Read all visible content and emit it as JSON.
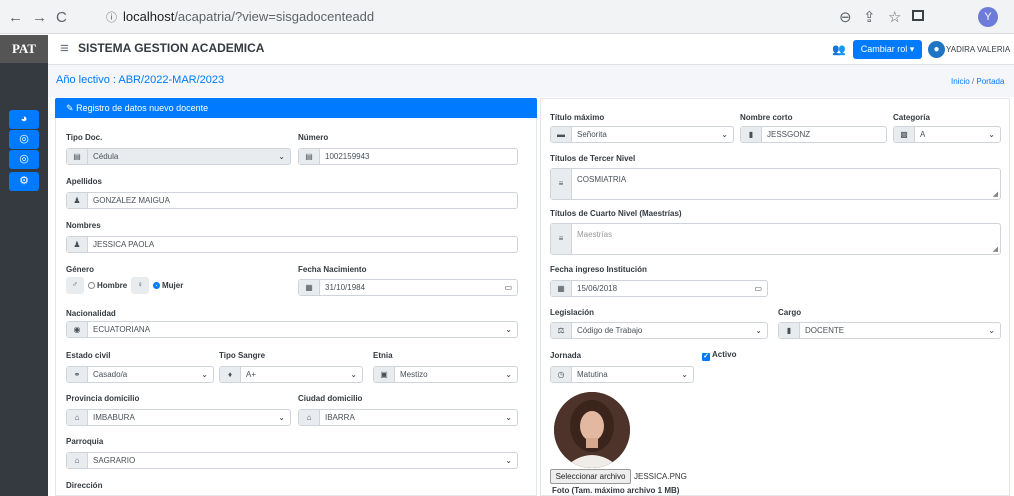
{
  "browser": {
    "url_host": "localhost",
    "url_path": "/acapatria/?view=sisgadocenteadd",
    "profile_initial": "Y"
  },
  "app": {
    "logo": "PAT",
    "title": "SISTEMA GESTION ACADEMICA",
    "role_button": "Cambiar rol",
    "user_name": "YADIRA VALERIA",
    "academic_year": "Año lectivo : ABR/2022-MAR/2023",
    "breadcrumb_home": "Inicio",
    "breadcrumb_sep": "/",
    "breadcrumb_current": "Portada",
    "sidebar_icons": [
      "dashboard-icon",
      "circle-icon",
      "circle-icon",
      "cogs-icon"
    ]
  },
  "form": {
    "header": "Registro de datos nuevo docente",
    "tipo_doc_label": "Tipo Doc.",
    "tipo_doc_value": "Cédula",
    "numero_label": "Número",
    "numero_value": "1002159943",
    "apellidos_label": "Apellidos",
    "apellidos_value": "GONZALEZ MAIGUA",
    "nombres_label": "Nombres",
    "nombres_value": "JESSICA PAOLA",
    "genero_label": "Género",
    "genero_hombre": "Hombre",
    "genero_mujer": "Mujer",
    "genero_selected": "Mujer",
    "fecha_nac_label": "Fecha Nacimiento",
    "fecha_nac_value": "31/10/1984",
    "nacionalidad_label": "Nacionalidad",
    "nacionalidad_value": "ECUATORIANA",
    "estado_civil_label": "Estado civil",
    "estado_civil_value": "Casado/a",
    "tipo_sangre_label": "Tipo Sangre",
    "tipo_sangre_value": "A+",
    "etnia_label": "Etnia",
    "etnia_value": "Mestizo",
    "provincia_label": "Provincia domicilio",
    "provincia_value": "IMBABURA",
    "ciudad_label": "Ciudad domicilio",
    "ciudad_value": "IBARRA",
    "parroquia_label": "Parroquia",
    "parroquia_value": "SAGRARIO",
    "direccion_label": "Dirección",
    "titulo_max_label": "Título máximo",
    "titulo_max_value": "Señorita",
    "nombre_corto_label": "Nombre corto",
    "nombre_corto_value": "JESSGONZ",
    "categoria_label": "Categoría",
    "categoria_value": "A",
    "titulos_tercer_label": "Títulos de Tercer Nivel",
    "titulos_tercer_value": "COSMIATRIA",
    "titulos_cuarto_label": "Títulos de Cuarto Nivel (Maestrías)",
    "titulos_cuarto_placeholder": "Maestrías",
    "fecha_ingreso_label": "Fecha ingreso Institución",
    "fecha_ingreso_value": "15/06/2018",
    "legislacion_label": "Legislación",
    "legislacion_value": "Código de Trabajo",
    "cargo_label": "Cargo",
    "cargo_value": "DOCENTE",
    "jornada_label": "Jornada",
    "jornada_value": "Matutina",
    "activo_label": "Activo",
    "activo_checked": true,
    "file_button": "Seleccionar archivo",
    "file_name": "JESSICA.PNG",
    "photo_caption": "Foto (Tam. máximo archivo 1 MB)"
  }
}
